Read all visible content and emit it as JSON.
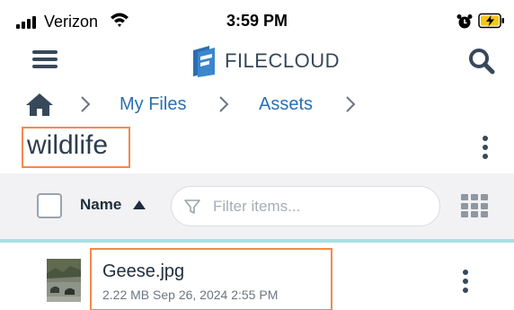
{
  "status_bar": {
    "carrier": "Verizon",
    "time": "3:59 PM",
    "icons": [
      "signal-bars-icon",
      "wifi-icon",
      "alarm-icon",
      "battery-charging-icon"
    ],
    "battery_color": "#f5c518"
  },
  "header": {
    "brand": "FILECLOUD",
    "menu_icon": "hamburger-icon",
    "search_icon": "search-icon",
    "brand_color": "#2b6fb1"
  },
  "breadcrumb": {
    "home_icon": "home-icon",
    "items": [
      {
        "label": "My Files"
      },
      {
        "label": "Assets"
      }
    ],
    "link_color": "#2b6fb1"
  },
  "folder": {
    "title": "wildlife",
    "menu_icon": "kebab-icon"
  },
  "toolbar": {
    "sort_label": "Name",
    "sort_direction": "ascending",
    "filter_placeholder": "Filter items...",
    "filter_value": "",
    "view_icon": "grid-view-icon"
  },
  "files": [
    {
      "name": "Geese.jpg",
      "meta": "2.22 MB Sep 26, 2024 2:55 PM",
      "thumbnail_icon": "image-thumbnail-icon"
    }
  ],
  "highlight_color": "#f28a4b"
}
